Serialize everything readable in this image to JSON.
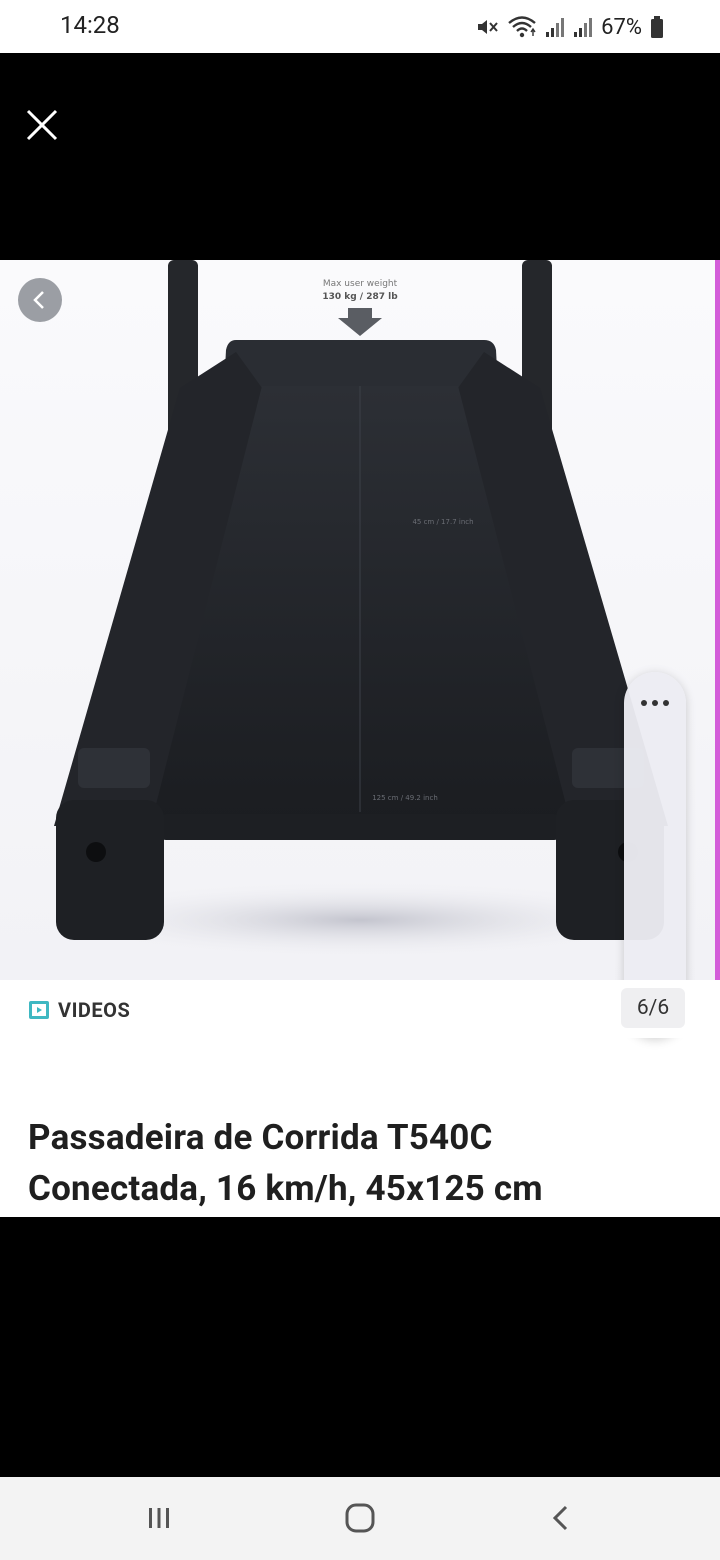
{
  "status_bar": {
    "time": "14:28",
    "battery_percent": "67%",
    "icons": [
      "mute-icon",
      "wifi-icon",
      "signal-icon",
      "signal-icon",
      "battery-icon"
    ]
  },
  "viewer": {
    "close_icon": "close-icon",
    "prev_icon": "chevron-left-icon",
    "more_icon": "more-horizontal-icon",
    "music_icon": "music-off-icon",
    "image": {
      "max_user_weight_title": "Max user weight",
      "max_user_weight_value": "130 kg / 287 lb",
      "belt_width": "45 cm / 17.7 inch",
      "belt_length": "125 cm / 49.2 inch"
    },
    "videos_label": "VIDEOS",
    "counter": "6/6",
    "title_line1": "Passadeira de Corrida T540C",
    "title_line2": "Conectada, 16 km/h, 45x125 cm"
  },
  "nav_bar": {
    "recents_icon": "recents-icon",
    "home_icon": "home-icon",
    "back_icon": "back-icon"
  },
  "colors": {
    "accent_edge": "#d35dd9",
    "video_icon": "#3fb8c2"
  }
}
